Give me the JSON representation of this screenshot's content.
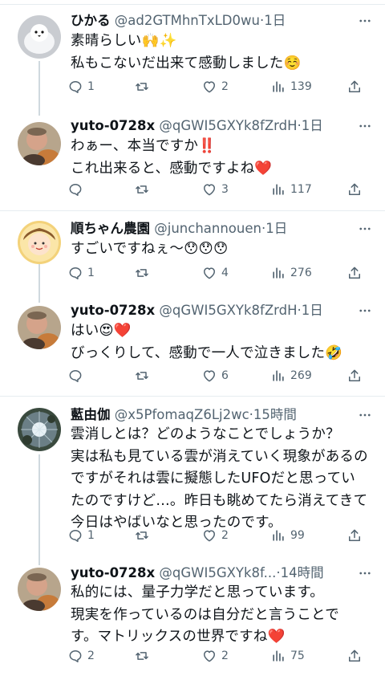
{
  "posts": [
    {
      "name": "ひかる",
      "handle": "@ad2GTMhnTxLD0wu",
      "dot": "·",
      "time": "1日",
      "lines": [
        "素晴らしい🙌✨",
        "私もこないだ出来て感動しました☺️"
      ],
      "replies": "1",
      "retweets": "",
      "likes": "2",
      "views": "139"
    },
    {
      "name": "yuto-0728x",
      "handle": "@qGWI5GXYk8fZrdH",
      "dot": "·",
      "time": "1日",
      "lines": [
        "わぁー、本当ですか‼️",
        "これ出来ると、感動ですよね❤️"
      ],
      "replies": "",
      "retweets": "",
      "likes": "3",
      "views": "117"
    },
    {
      "name": "順ちゃん農園",
      "handle": "@junchannouen",
      "dot": "·",
      "time": "1日",
      "lines": [
        "すごいですねぇ〜😯😯😯"
      ],
      "replies": "1",
      "retweets": "",
      "likes": "4",
      "views": "276"
    },
    {
      "name": "yuto-0728x",
      "handle": "@qGWI5GXYk8fZrdH",
      "dot": "·",
      "time": "1日",
      "lines": [
        "はい😍❤️",
        "びっくりして、感動で一人で泣きました🤣"
      ],
      "replies": "",
      "retweets": "",
      "likes": "6",
      "views": "269"
    },
    {
      "name": "藍由伽",
      "handle": "@x5PfomaqZ6Lj2wc",
      "dot": "·",
      "time": "15時間",
      "lines": [
        "雲消しとは？どのようなことでしょうか？",
        "実は私も見ている雲が消えていく現象があるの",
        "ですがそれは雲に擬態したUFOだと思ってい",
        "たのですけど…。昨日も眺めてたら消えてきて",
        "今日はやばいなと思ったのです。"
      ],
      "replies": "1",
      "retweets": "",
      "likes": "2",
      "views": "99"
    },
    {
      "name": "yuto-0728x",
      "handle": "@qGWI5GXYk8f...",
      "dot": "·",
      "time": "14時間",
      "lines": [
        "私的には、量子力学だと思っています。",
        "現実を作っているのは自分だと言うことで",
        "す。マトリックスの世界ですね❤️"
      ],
      "replies": "2",
      "retweets": "",
      "likes": "2",
      "views": "75"
    }
  ],
  "icons": {
    "reply": "reply-icon",
    "retweet": "retweet-icon",
    "like": "heart-icon",
    "views": "views-icon",
    "share": "share-icon",
    "more": "more-icon"
  },
  "colors": {
    "text": "#0f1419",
    "secondary": "#536471",
    "thread_line": "#cfd9de",
    "separator": "#e6ecf0",
    "heart_emoji": "#e0245e"
  }
}
